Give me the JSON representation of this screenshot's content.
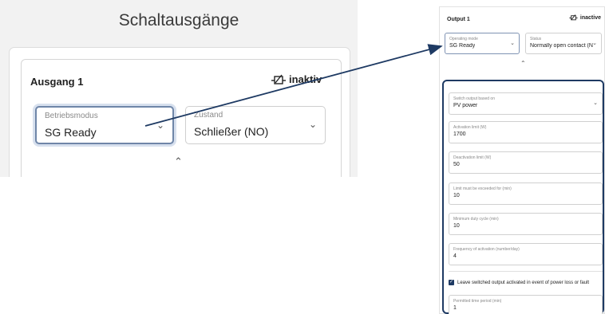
{
  "left": {
    "title": "Schaltausgänge",
    "output_label": "Ausgang 1",
    "state_label": "inaktiv",
    "operating_mode": {
      "label": "Betriebsmodus",
      "value": "SG Ready"
    },
    "status": {
      "label": "Zustand",
      "value": "Schließer (NO)"
    }
  },
  "right": {
    "output_label": "Output 1",
    "state_label": "inactive",
    "operating_mode": {
      "label": "Operating mode",
      "value": "SG Ready"
    },
    "status": {
      "label": "Status",
      "value": "Normally open contact (N"
    },
    "fields": {
      "switch_based_on": {
        "label": "Switch output based on",
        "value": "PV power"
      },
      "activation_limit": {
        "label": "Activation limit (W)",
        "value": "1700"
      },
      "deactivation_limit": {
        "label": "Deactivation limit (W)",
        "value": "50"
      },
      "limit_exceeded": {
        "label": "Limit must be exceeded for (min)",
        "value": "10"
      },
      "min_duty_cycle": {
        "label": "Minimum duty cycle (min)",
        "value": "10"
      },
      "activation_frequency": {
        "label": "Frequency of activation (number/day)",
        "value": "4"
      },
      "permitted_time": {
        "label": "Permitted time period (min)",
        "value": "1"
      }
    },
    "checkbox": {
      "label": "Leave switched output activated in event of power loss or fault",
      "checked": true
    }
  },
  "icons": {
    "relay_open": "relay-open-icon",
    "chevron_down": "chevron-down-icon",
    "chevron_up": "chevron-up-icon",
    "check": "check-icon"
  },
  "colors": {
    "accent": "#1e3a63",
    "focus_border": "#6f86a8",
    "left_bg": "#f2f2f2"
  }
}
